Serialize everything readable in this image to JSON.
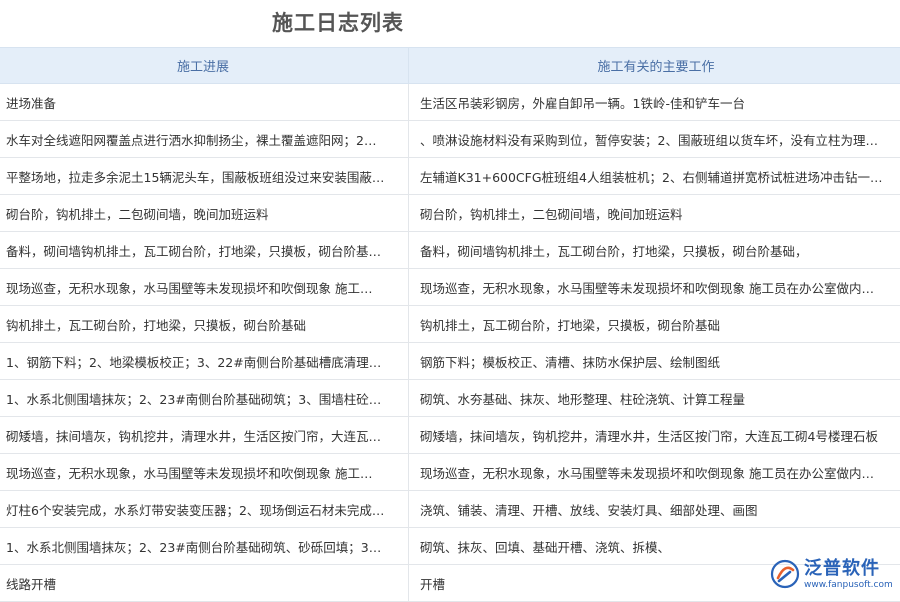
{
  "page": {
    "title": "施工日志列表"
  },
  "table": {
    "columns": [
      "施工进展",
      "施工有关的主要工作"
    ],
    "rows": [
      [
        "进场准备",
        "生活区吊装彩钢房，外雇自卸吊一辆。1铁岭-佳和铲车一台"
      ],
      [
        "水车对全线遮阳网覆盖点进行洒水抑制扬尘，裸土覆盖遮阳网；2…",
        "、喷淋设施材料没有采购到位，暂停安装；2、围蔽班组以货车坏，没有立柱为理…"
      ],
      [
        "平整场地，拉走多余泥土15辆泥头车，围蔽板班组没过来安装围蔽…",
        "左辅道K31+600CFG桩班组4人组装桩机；2、右侧辅道拼宽桥试桩进场冲击钻一…"
      ],
      [
        "砌台阶，钩机排土，二包砌间墙，晚间加班运料",
        "砌台阶，钩机排土，二包砌间墙，晚间加班运料"
      ],
      [
        "备料，砌间墙钩机排土，瓦工砌台阶，打地梁，只摸板，砌台阶基…",
        "备料，砌间墙钩机排土，瓦工砌台阶，打地梁，只摸板，砌台阶基础，"
      ],
      [
        "现场巡查，无积水现象，水马围壁等未发现损坏和吹倒现象 施工…",
        "现场巡查，无积水现象，水马围壁等未发现损坏和吹倒现象 施工员在办公室做内…"
      ],
      [
        "钩机排土，瓦工砌台阶，打地梁，只摸板，砌台阶基础",
        "钩机排土，瓦工砌台阶，打地梁，只摸板，砌台阶基础"
      ],
      [
        "1、钢筋下料；2、地梁模板校正；3、22#南侧台阶基础槽底清理…",
        "钢筋下料；模板校正、清槽、抹防水保护层、绘制图纸"
      ],
      [
        "1、水系北侧围墙抹灰；2、23#南侧台阶基础砌筑；3、围墙柱砼…",
        "砌筑、水夯基础、抹灰、地形整理、柱砼浇筑、计算工程量"
      ],
      [
        "砌矮墙，抹间墙灰，钩机挖井，清理水井，生活区按门帘，大连瓦…",
        "砌矮墙，抹间墙灰，钩机挖井，清理水井，生活区按门帘，大连瓦工砌4号楼理石板"
      ],
      [
        "现场巡查，无积水现象，水马围壁等未发现损坏和吹倒现象 施工…",
        "现场巡查，无积水现象，水马围壁等未发现损坏和吹倒现象 施工员在办公室做内…"
      ],
      [
        "灯柱6个安装完成，水系灯带安装变压器；2、现场倒运石材未完成…",
        "浇筑、铺装、清理、开槽、放线、安装灯具、细部处理、画图"
      ],
      [
        "1、水系北侧围墙抹灰；2、23#南侧台阶基础砌筑、砂砾回填；3…",
        "砌筑、抹灰、回填、基础开槽、浇筑、拆模、"
      ],
      [
        "线路开槽",
        "开槽"
      ]
    ]
  },
  "logo": {
    "name": "泛普软件",
    "url": "www.fanpusoft.com",
    "color": "#2a63b8",
    "accent": "#e8612c"
  }
}
